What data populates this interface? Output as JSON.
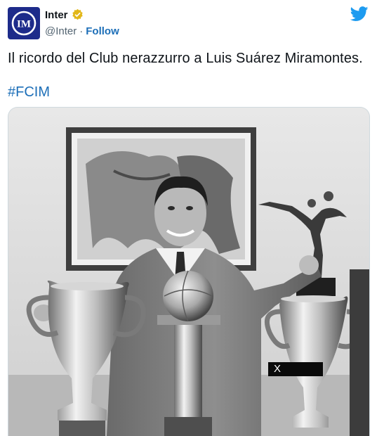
{
  "author": {
    "name": "Inter",
    "handle": "@Inter",
    "separator": "·",
    "follow_label": "Follow"
  },
  "tweet": {
    "text": "Il ricordo del Club nerazzurro a Luis Suárez Miramontes.",
    "hashtag": "#FCIM"
  },
  "photo": {
    "overlay_label": "X"
  },
  "icons": {
    "avatar": "inter-logo",
    "verified": "verified-badge-icon",
    "brand": "twitter-bird-icon"
  },
  "colors": {
    "link": "#1d6fb8",
    "twitter_blue": "#1d9bf0",
    "inter_blue": "#1d2b8a",
    "verified_gold": "#e2b719"
  }
}
